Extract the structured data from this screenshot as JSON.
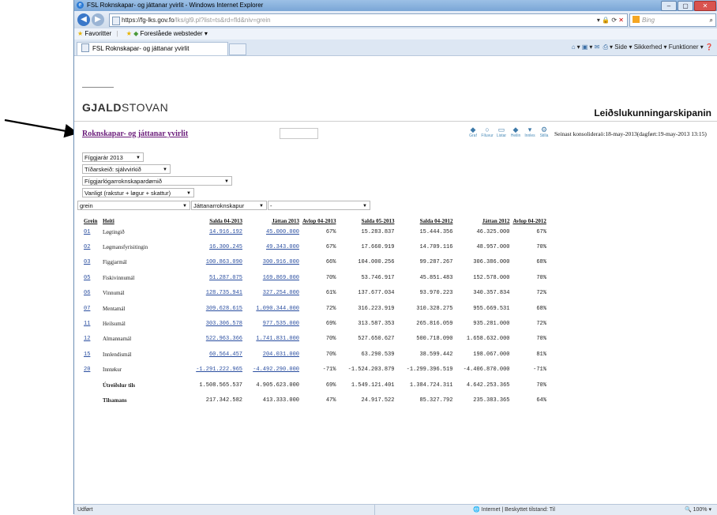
{
  "window": {
    "title": "FSL Roknskapar- og játtanar yvirlit - Windows Internet Explorer",
    "buttons": {
      "minimize": "–",
      "maximize": "▢",
      "close": "✕"
    }
  },
  "browser": {
    "url_host": "https://fg-lks.gov.fo",
    "url_rest": "/lks/gl9.pl?list=ts&rd=fld&niv=grein",
    "search_placeholder": "Bing",
    "favorites_label": "Favoritter",
    "suggested_sites_label": "Foreslåede websteder ▾",
    "tab_title": "FSL Roknskapar- og játtanar yvirlit",
    "commands": {
      "page": "Side ▾",
      "safety": "Sikkerhed ▾",
      "tools": "Funktioner ▾"
    }
  },
  "page": {
    "logo_bold": "GJALD",
    "logo_rest": "STOVAN",
    "banner": "Leiðslukunningarskipanin",
    "title": "Roknskapar- og játtanar yvirlit",
    "consolidation": "Seinast konsolideraö:18-may-2013(dagført:19-may-2013 13:15)",
    "tools": [
      {
        "label": "Graf",
        "glyph": "◆"
      },
      {
        "label": "Fíluvur",
        "glyph": "○"
      },
      {
        "label": "Listar",
        "glyph": "▭"
      },
      {
        "label": "Heilin",
        "glyph": "◆"
      },
      {
        "label": "Innles",
        "glyph": "▾"
      },
      {
        "label": "Stilla",
        "glyph": "⚙"
      }
    ],
    "filters": {
      "year": "Fíggjarár 2013",
      "period": "Tíðarskeið: sjálvvirkið",
      "area": "Fíggjarlógarroknskapardømið",
      "type": "Vanligt (rakstur + løgur + skattur)",
      "level": "grein",
      "measure": "Játtanarroknskapur",
      "extra": "-"
    }
  },
  "table": {
    "headers": [
      "Grein",
      "Heiti",
      "Salda 04-2013",
      "Játtan 2013",
      "Avlop 04-2013",
      "Salda 05-2013",
      "Salda 04-2012",
      "Játtan 2012",
      "Avlop 04-2012"
    ],
    "rows": [
      {
        "code": "01",
        "name": "Løgtingið",
        "v": [
          "14.916.192",
          "45.000.000",
          "67%",
          "15.283.837",
          "15.444.356",
          "46.325.000",
          "67%"
        ]
      },
      {
        "code": "02",
        "name": "Løgmansfyrisitingin",
        "v": [
          "16.300.245",
          "49.343.000",
          "67%",
          "17.660.919",
          "14.709.116",
          "48.957.000",
          "70%"
        ]
      },
      {
        "code": "03",
        "name": "Fíggjarmál",
        "v": [
          "100.863.090",
          "300.916.000",
          "66%",
          "104.000.256",
          "99.287.267",
          "306.386.000",
          "68%"
        ]
      },
      {
        "code": "05",
        "name": "Fiskivinnumál",
        "v": [
          "51.287.075",
          "169.869.000",
          "70%",
          "53.746.917",
          "45.851.483",
          "152.578.000",
          "70%"
        ]
      },
      {
        "code": "06",
        "name": "Vinnumál",
        "v": [
          "128.735.941",
          "327.254.000",
          "61%",
          "137.677.034",
          "93.970.223",
          "340.357.834",
          "72%"
        ]
      },
      {
        "code": "07",
        "name": "Mentamál",
        "v": [
          "309.628.615",
          "1.090.344.000",
          "72%",
          "316.223.919",
          "310.328.275",
          "955.669.531",
          "68%"
        ]
      },
      {
        "code": "11",
        "name": "Heilsumál",
        "v": [
          "303.306.578",
          "977.535.000",
          "69%",
          "313.587.353",
          "265.816.059",
          "935.281.000",
          "72%"
        ]
      },
      {
        "code": "12",
        "name": "Almannamál",
        "v": [
          "522.963.366",
          "1.741.831.000",
          "70%",
          "527.650.627",
          "500.718.090",
          "1.658.632.000",
          "70%"
        ]
      },
      {
        "code": "15",
        "name": "Innlendismál",
        "v": [
          "60.564.457",
          "204.031.000",
          "70%",
          "63.290.539",
          "38.599.442",
          "198.067.000",
          "81%"
        ]
      },
      {
        "code": "20",
        "name": "Inntøkur",
        "v": [
          "-1.291.222.965",
          "-4.492.290.000",
          "-71%",
          "-1.524.203.879",
          "-1.299.396.519",
          "-4.406.870.000",
          "-71%"
        ]
      },
      {
        "code": "",
        "name": "Útreiðslur tils",
        "bold": true,
        "v": [
          "1.508.565.537",
          "4.905.623.000",
          "69%",
          "1.549.121.401",
          "1.384.724.311",
          "4.642.253.365",
          "70%"
        ]
      },
      {
        "code": "",
        "name": "Tilsamans",
        "bold": true,
        "v": [
          "217.342.582",
          "413.333.000",
          "47%",
          "24.917.522",
          "85.327.792",
          "235.383.365",
          "64%"
        ]
      }
    ]
  },
  "status": {
    "left": "Udført",
    "middle": "Internet | Beskyttet tilstand: Til",
    "zoom": "100%"
  }
}
